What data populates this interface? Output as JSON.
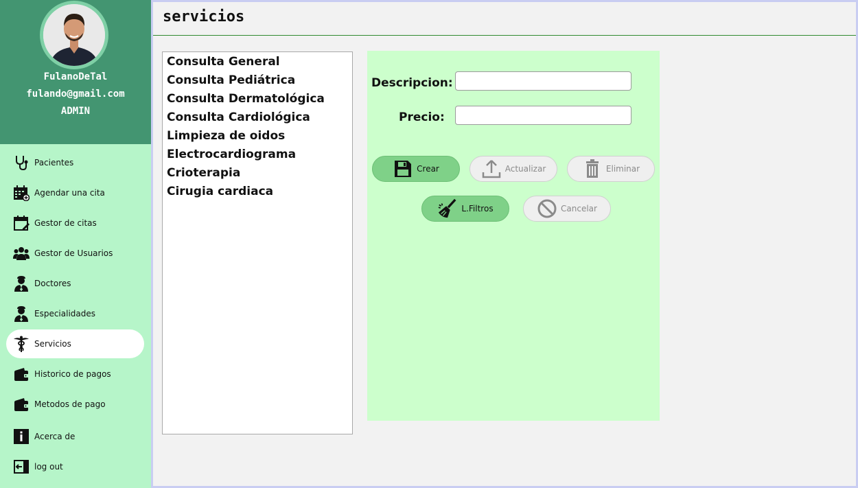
{
  "window": {
    "title": "servicios"
  },
  "profile": {
    "name": "FulanoDeTal",
    "email": "fulando@gmail.com",
    "role": "ADMIN"
  },
  "sidebar": {
    "items": [
      {
        "label": "Pacientes",
        "icon": "stethoscope-icon"
      },
      {
        "label": "Agendar una cita",
        "icon": "calendar-add-icon"
      },
      {
        "label": "Gestor de citas",
        "icon": "calendar-edit-icon"
      },
      {
        "label": "Gestor de Usuarios",
        "icon": "users-icon"
      },
      {
        "label": "Doctores",
        "icon": "doctor-icon"
      },
      {
        "label": "Especialidades",
        "icon": "doctor-icon"
      },
      {
        "label": "Servicios",
        "icon": "caduceus-icon",
        "active": true
      },
      {
        "label": "Historico de pagos",
        "icon": "wallet-icon"
      },
      {
        "label": "Metodos de pago",
        "icon": "wallet-icon"
      },
      {
        "label": "Acerca de",
        "icon": "info-icon"
      },
      {
        "label": "log out",
        "icon": "logout-icon"
      }
    ]
  },
  "services": {
    "items": [
      "Consulta General",
      "Consulta Pediátrica",
      "Consulta Dermatológica",
      "Consulta Cardiológica",
      "Limpieza de oidos",
      "Electrocardiograma",
      "Crioterapia",
      "Cirugia cardiaca"
    ]
  },
  "form": {
    "descripcion_label": "Descripcion:",
    "descripcion_value": "",
    "precio_label": "Precio:",
    "precio_value": ""
  },
  "buttons": {
    "crear": "Crear",
    "actualizar": "Actualizar",
    "eliminar": "Eliminar",
    "filtros": "L.Filtros",
    "cancelar": "Cancelar"
  },
  "colors": {
    "sidebar_bg": "#b6f5c9",
    "profile_bg": "#439571",
    "form_bg": "#ccffcc",
    "active_button": "#7fd188"
  }
}
